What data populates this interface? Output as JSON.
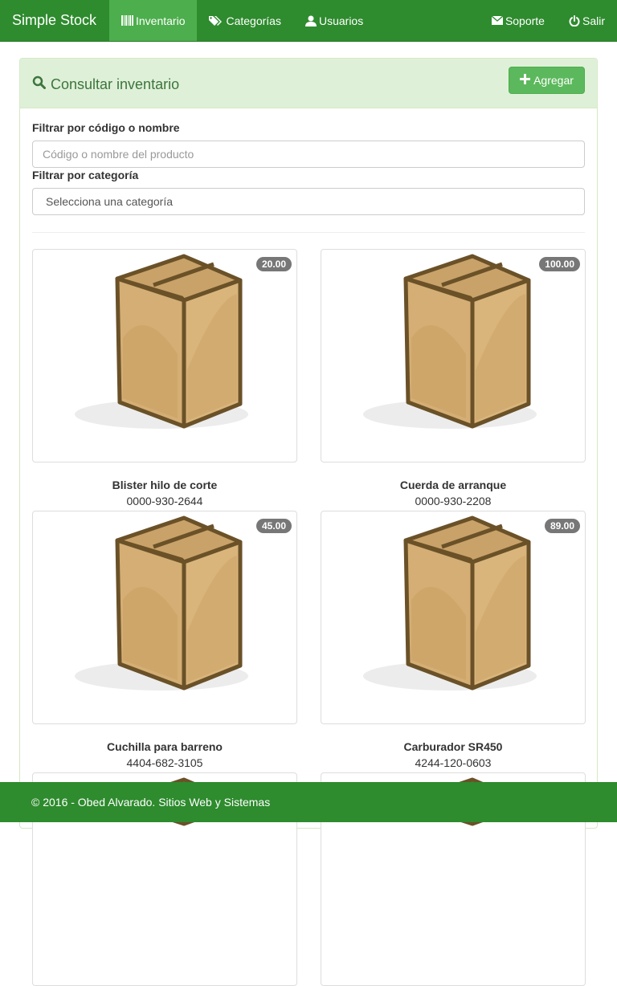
{
  "navbar": {
    "brand": "Simple Stock",
    "links": [
      {
        "label": "Inventario",
        "icon": "barcode-icon",
        "active": true
      },
      {
        "label": "Categorías",
        "icon": "tags-icon",
        "active": false
      },
      {
        "label": "Usuarios",
        "icon": "user-icon",
        "active": false
      },
      {
        "label": "Soporte",
        "icon": "envelope-icon",
        "active": false
      },
      {
        "label": "Salir",
        "icon": "power-off-icon",
        "active": false
      }
    ]
  },
  "panel": {
    "title": "Consultar inventario",
    "add_button": "Agregar"
  },
  "filters": {
    "name_label": "Filtrar por código o nombre",
    "name_placeholder": "Código o nombre del producto",
    "category_label": "Filtrar por categoría",
    "category_selected": "Selecciona una categoría"
  },
  "products": [
    {
      "name": "Blister hilo de corte",
      "code": "0000-930-2644",
      "stock": "20.00"
    },
    {
      "name": "Cuerda de arranque",
      "code": "0000-930-2208",
      "stock": "100.00"
    },
    {
      "name": "Cuchilla para barreno",
      "code": "4404-682-3105",
      "stock": "45.00"
    },
    {
      "name": "Carburador SR450",
      "code": "4244-120-0603",
      "stock": "89.00"
    }
  ],
  "footer": {
    "text": "© 2016 - Obed Alvarado. Sitios Web y Sistemas"
  },
  "colors": {
    "navbar": "#2e8b2e",
    "navbar_active": "#4cae4c",
    "panel_heading": "#dff0d8",
    "panel_title": "#3c763d",
    "add_button": "#5cb85c",
    "badge": "#777777"
  }
}
